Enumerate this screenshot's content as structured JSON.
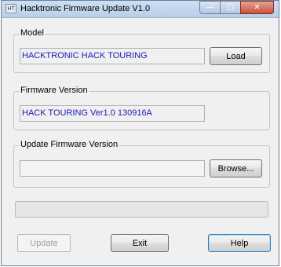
{
  "window": {
    "title": "Hacktronic Firmware Update V1.0",
    "app_icon_text": "HT"
  },
  "model": {
    "legend": "Model",
    "value": "HACKTRONIC HACK TOURING",
    "load_label": "Load"
  },
  "firmware": {
    "legend": "Firmware Version",
    "value": "HACK TOURING Ver1.0 130916A"
  },
  "update_firmware": {
    "legend": "Update Firmware Version",
    "path_value": "",
    "browse_label": "Browse..."
  },
  "progress": {
    "value": 0
  },
  "buttons": {
    "update_label": "Update",
    "exit_label": "Exit",
    "help_label": "Help"
  },
  "colors": {
    "value_text": "#1a1ab8",
    "close_button": "#c9513b"
  }
}
